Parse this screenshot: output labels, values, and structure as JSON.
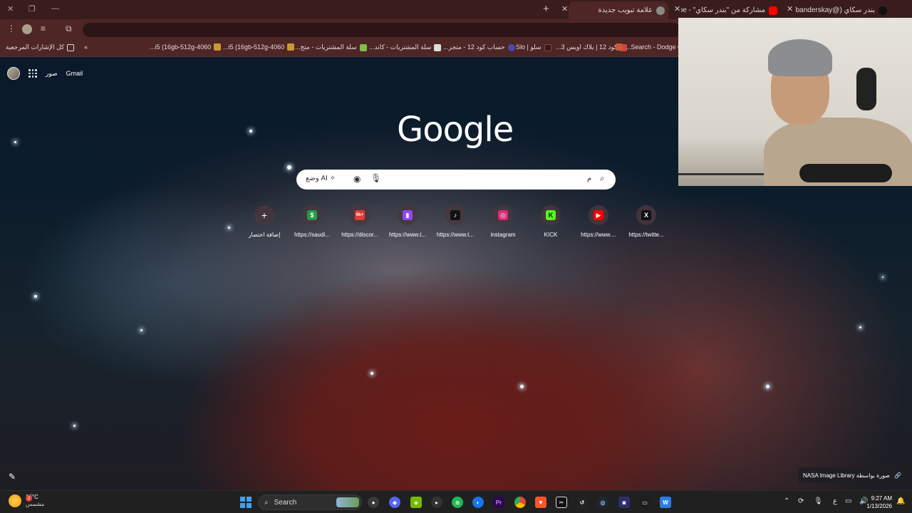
{
  "tabs": [
    {
      "title": "بندر سكاي (@banderskay) | TikTok",
      "active": false
    },
    {
      "title": "مشاركة من \"بندر سكاي\" - YouTube",
      "active": false
    },
    {
      "title": "علامة تبويب جديدة",
      "active": true
    }
  ],
  "bookmarks": {
    "all_bookmarks": "كل الإشارات المرجعية",
    "items": [
      "Search - Dodge Cha...",
      "كود 12 | بلاك اوبس 3...",
      "سلو | Slo",
      "حساب كود 12 - متجر...",
      "سلة المشتريات - كاند...",
      "سلة المشتريات - متج...",
      "4060-i5 (16gb-512g...",
      "4060-i5 (16gb-512g..."
    ]
  },
  "ntp": {
    "gmail": "Gmail",
    "images": "صور",
    "logo": "Google",
    "search_prefix": "م",
    "ai_mode": "وضع AI"
  },
  "shortcuts": [
    {
      "label": "إضافة اختصار",
      "icon": "plus-icon",
      "color": "#4a3c40"
    },
    {
      "label": "https://saudi...",
      "icon": "dollar-icon",
      "color": "#1e9e4a"
    },
    {
      "label": "https://discor...",
      "icon": "discord-icon",
      "color": "#e53935",
      "badge": "9k+"
    },
    {
      "label": "https://www.t...",
      "icon": "twitch-icon",
      "color": "#9146ff"
    },
    {
      "label": "https://www.t...",
      "icon": "tiktok-icon",
      "color": "#111111"
    },
    {
      "label": "instagram",
      "icon": "instagram-icon",
      "color": "#dd2a7b"
    },
    {
      "label": "KICK",
      "icon": "kick-icon",
      "color": "#53fc18"
    },
    {
      "label": "https://www....",
      "icon": "youtube-icon",
      "color": "#ff0000"
    },
    {
      "label": "https://twitte...",
      "icon": "x-icon",
      "color": "#111111"
    }
  ],
  "credit": {
    "text": "صورة بواسطة NASA Image Library"
  },
  "taskbar": {
    "weather_temp": "16°C",
    "weather_desc": "مشمس",
    "weather_badge": "2",
    "search_label": "Search",
    "lang": "ع",
    "time": "9:27 AM",
    "date": "1/13/2026"
  }
}
